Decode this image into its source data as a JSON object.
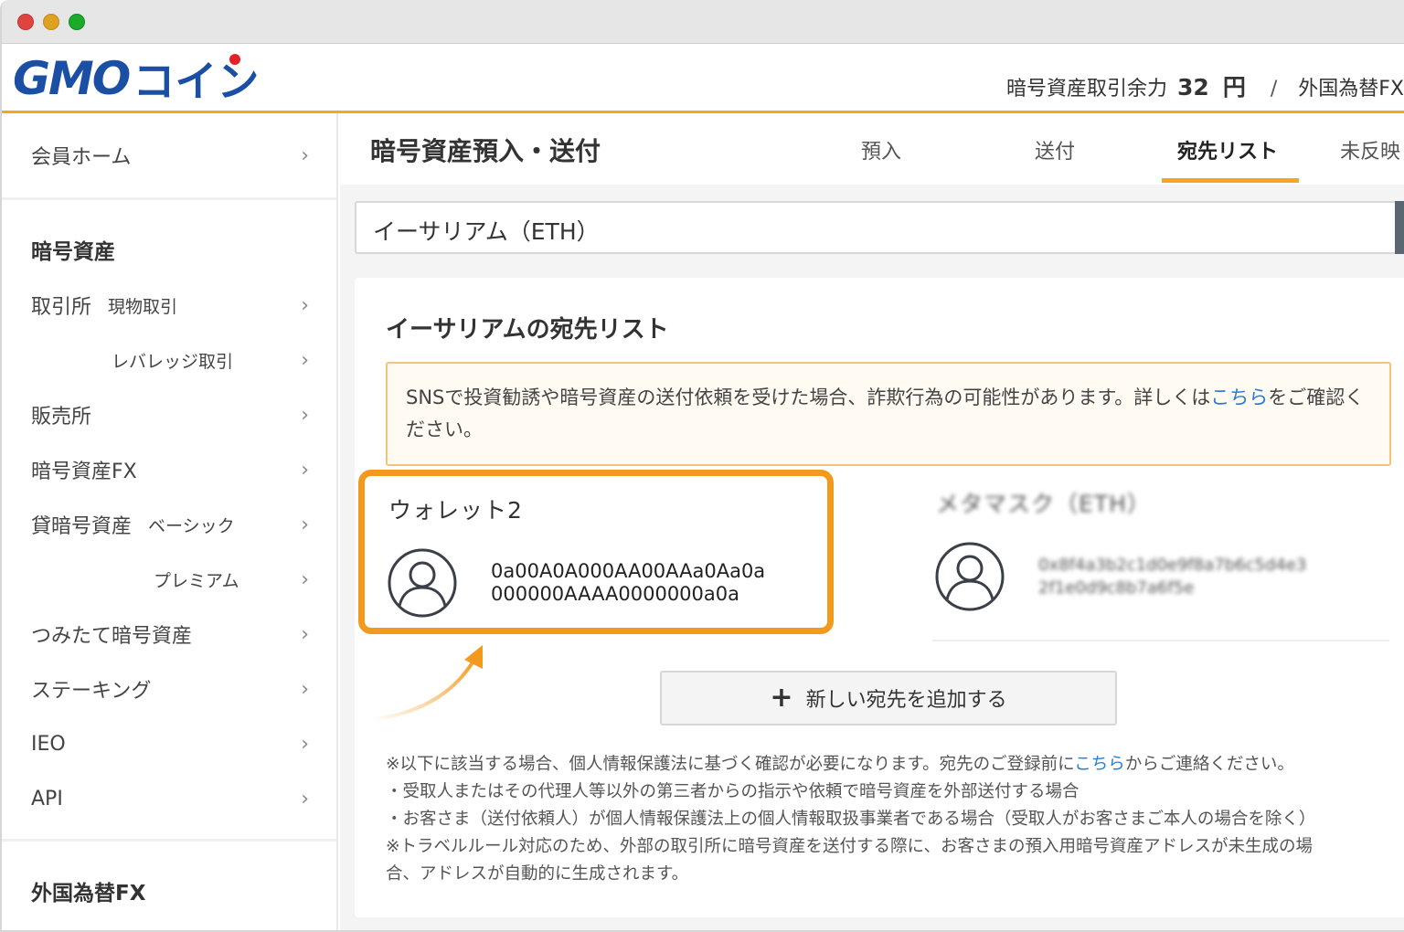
{
  "header": {
    "logo_text": "GMO",
    "logo_coin": "コイン",
    "balance_label": "暗号資産取引余力",
    "balance_value": "32",
    "balance_unit": "円",
    "separator": "/",
    "fx_label": "外国為替FX"
  },
  "sidebar": {
    "member_home": "会員ホーム",
    "crypto_heading": "暗号資産",
    "exchange_label": "取引所",
    "spot_label": "現物取引",
    "leverage_label": "レバレッジ取引",
    "sales_label": "販売所",
    "crypto_fx_label": "暗号資産FX",
    "lending_label": "貸暗号資産",
    "basic_label": "ベーシック",
    "premium_label": "プレミアム",
    "tsumitate_label": "つみたて暗号資産",
    "staking_label": "ステーキング",
    "ieo_label": "IEO",
    "api_label": "API",
    "fx_heading": "外国為替FX",
    "chevron": "›"
  },
  "topbar": {
    "title": "暗号資産預入・送付",
    "tabs": [
      "預入",
      "送付",
      "宛先リスト",
      "未反映"
    ]
  },
  "select": {
    "value": "イーサリアム（ETH）"
  },
  "card": {
    "title": "イーサリアムの宛先リスト",
    "notice_text": "SNSで投資勧誘や暗号資産の送付依頼を受けた場合、詐欺行為の可能性があります。詳しくは",
    "notice_link": "こちら",
    "notice_text2": "をご確認ください。",
    "wallet1_name": "ウォレット2",
    "wallet1_address_line1": "0a00A0A000AA00AAa0Aa0a",
    "wallet1_address_line2": "000000AAAA0000000a0a",
    "wallet2_name": "メタマスク（ETH）",
    "wallet2_address_line1": "0x8f4a3b2c1d0e9f8a7b6c5d4e3",
    "wallet2_address_line2": "2f1e0d9c8b7a6f5e",
    "add_button": "新しい宛先を追加する",
    "note1_pre": "※以下に該当する場合、個人情報保護法に基づく確認が必要になります。宛先のご登録前に",
    "note1_link": "こちら",
    "note1_post": "からご連絡ください。",
    "note2": "・受取人またはその代理人等以外の第三者からの指示や依頼で暗号資産を外部送付する場合",
    "note3": "・お客さま（送付依頼人）が個人情報保護法上の個人情報取扱事業者である場合（受取人がお客さまご本人の場合を除く）",
    "note4": "※トラベルルール対応のため、外部の取引所に暗号資産を送付する際に、お客さまの預入用暗号資産アドレスが未生成の場",
    "note5": "合、アドレスが自動的に生成されます。"
  },
  "colors": {
    "accent": "#f5a623",
    "brand": "#1a4fa3",
    "link": "#2a7bd6"
  }
}
